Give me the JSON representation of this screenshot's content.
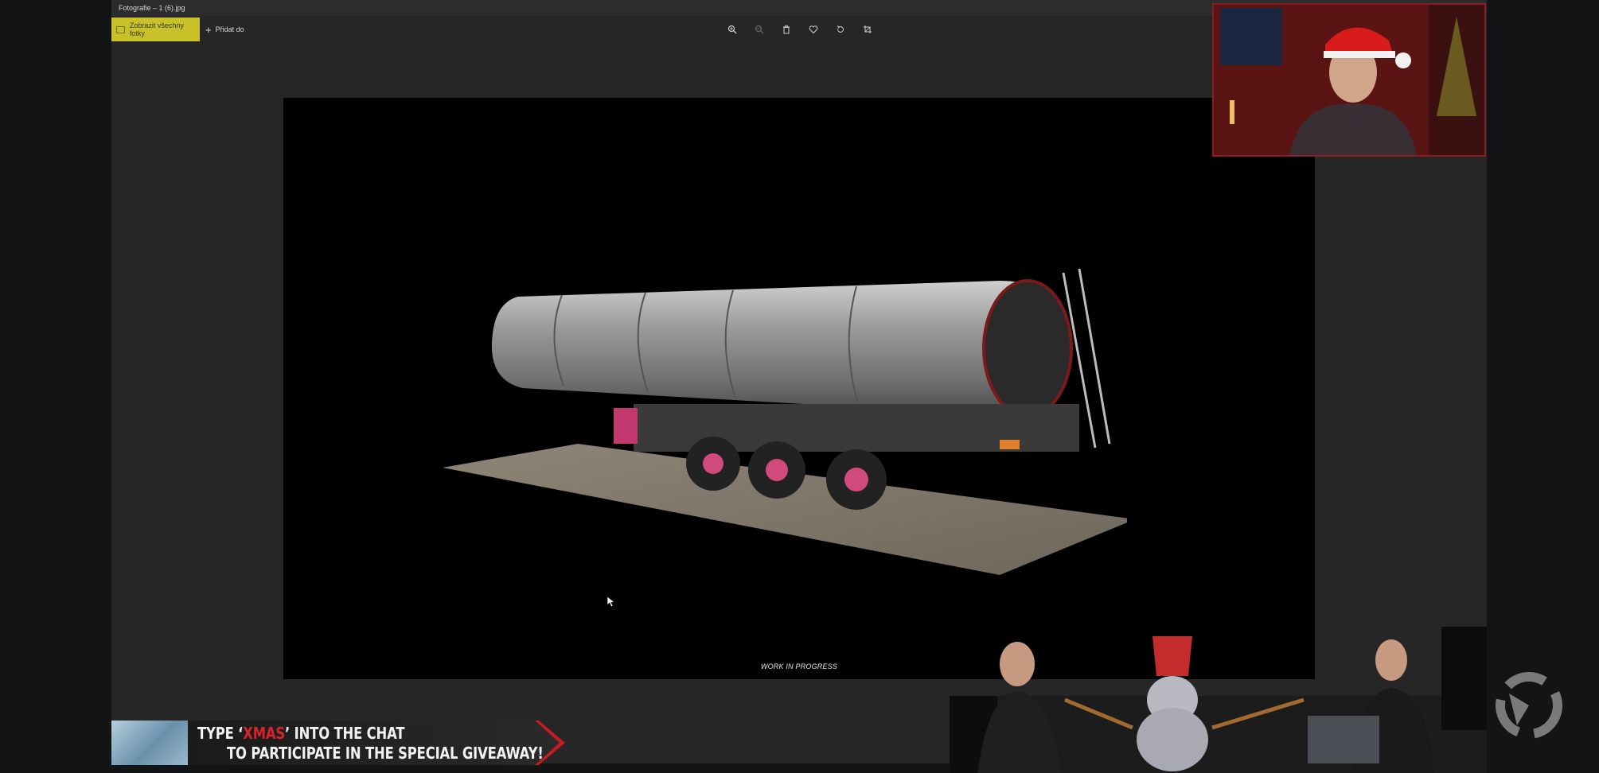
{
  "window": {
    "title": "Fotografie – 1 (6).jpg"
  },
  "toolbar": {
    "view_all_label": "Zobrazit všechny fotky",
    "add_to_label": "Přidat do",
    "tools": [
      {
        "icon": "zoom-in-icon"
      },
      {
        "icon": "zoom-out-icon"
      },
      {
        "icon": "delete-icon"
      },
      {
        "icon": "heart-icon"
      },
      {
        "icon": "rotate-icon"
      },
      {
        "icon": "crop-icon"
      }
    ]
  },
  "image": {
    "caption": "WORK IN PROGRESS"
  },
  "overlay": {
    "banner_line1_prefix": "TYPE ‘",
    "banner_keyword": "XMAS",
    "banner_line1_suffix": "’ INTO THE CHAT",
    "banner_line2": "TO PARTICIPATE IN THE SPECIAL GIVEAWAY!"
  },
  "colors": {
    "accent": "#c9c12a",
    "banner_red": "#d8232a",
    "webcam_border": "#8a1d20"
  }
}
